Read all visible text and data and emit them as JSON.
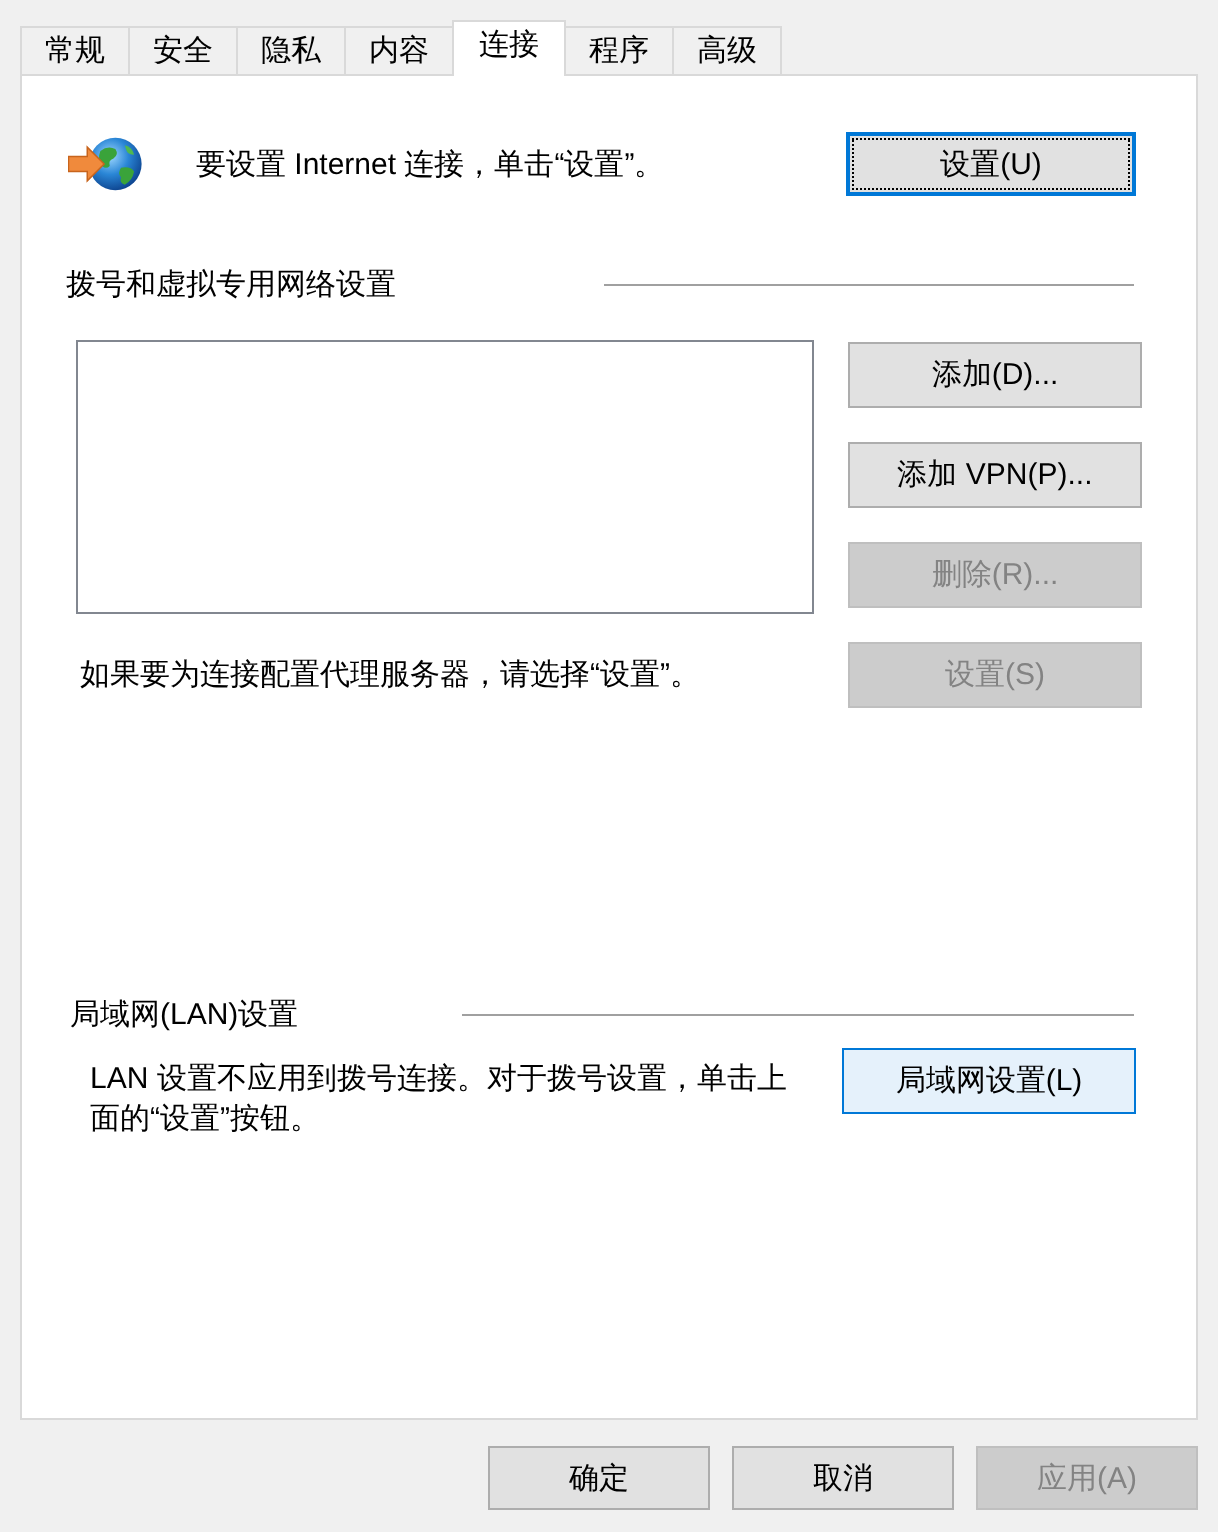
{
  "tabs": [
    {
      "label": "常规",
      "selected": false
    },
    {
      "label": "安全",
      "selected": false
    },
    {
      "label": "隐私",
      "selected": false
    },
    {
      "label": "内容",
      "selected": false
    },
    {
      "label": "连接",
      "selected": true
    },
    {
      "label": "程序",
      "selected": false
    },
    {
      "label": "高级",
      "selected": false
    }
  ],
  "internet_setup": {
    "text": "要设置 Internet 连接，单击“设置”。",
    "button": {
      "label": "设置(U)",
      "focused": true
    }
  },
  "dialup_vpn": {
    "title": "拨号和虚拟专用网络设置",
    "buttons": [
      {
        "label": "添加(D)...",
        "disabled": false
      },
      {
        "label": "添加 VPN(P)...",
        "disabled": false
      },
      {
        "label": "删除(R)...",
        "disabled": true
      },
      {
        "label": "设置(S)",
        "disabled": true
      }
    ],
    "proxy_note": "如果要为连接配置代理服务器，请选择“设置”。"
  },
  "lan": {
    "title": "局域网(LAN)设置",
    "text": "LAN 设置不应用到拨号连接。对于拨号设置，单击上面的“设置”按钮。",
    "button": {
      "label": "局域网设置(L)",
      "hovered": true
    }
  },
  "footer_buttons": [
    {
      "label": "确定",
      "disabled": false
    },
    {
      "label": "取消",
      "disabled": false
    },
    {
      "label": "应用(A)",
      "disabled": true
    }
  ]
}
